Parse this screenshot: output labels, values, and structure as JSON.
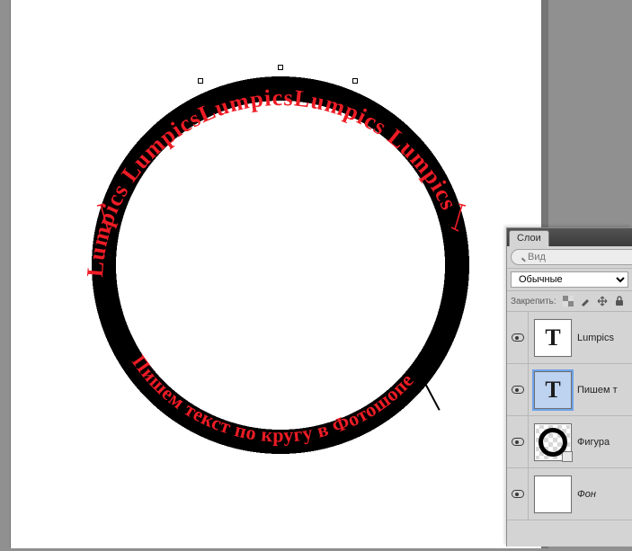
{
  "canvas": {
    "top_text": "Lumpics LumpicsLumpicsLumpics Lumpics",
    "bottom_text": "Пишем текст по кругу в Фотошопе",
    "text_color": "#ee1c25",
    "ring_color": "#000000"
  },
  "panel": {
    "tab_label": "Слои",
    "search_placeholder": "Вид",
    "blend_mode": "Обычные",
    "lock_label": "Закрепить:"
  },
  "layers": [
    {
      "name": "Lumpics",
      "type": "text",
      "selected": false,
      "italic": false
    },
    {
      "name": "Пишем т",
      "type": "text",
      "selected": true,
      "italic": false
    },
    {
      "name": "Фигура",
      "type": "shape",
      "selected": false,
      "italic": false
    },
    {
      "name": "Фон",
      "type": "bg",
      "selected": false,
      "italic": true
    }
  ]
}
